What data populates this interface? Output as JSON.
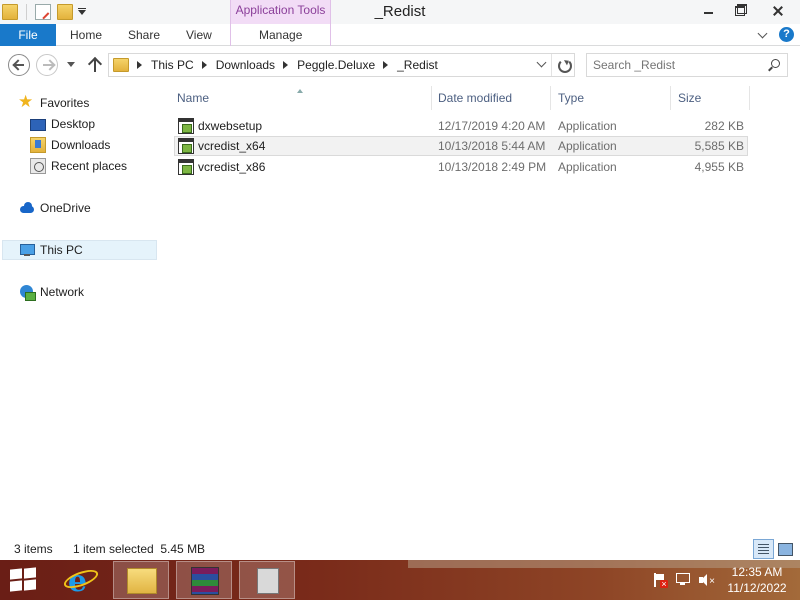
{
  "window": {
    "title": "_Redist",
    "contextual_tab_header": "Application Tools"
  },
  "ribbon": {
    "tabs": [
      "File",
      "Home",
      "Share",
      "View",
      "Manage"
    ],
    "help_label": "?"
  },
  "address": {
    "crumbs": [
      "This PC",
      "Downloads",
      "Peggle.Deluxe",
      "_Redist"
    ]
  },
  "search": {
    "placeholder": "Search _Redist"
  },
  "navpane": {
    "favorites": "Favorites",
    "desktop": "Desktop",
    "downloads": "Downloads",
    "recent_places": "Recent places",
    "onedrive": "OneDrive",
    "this_pc": "This PC",
    "network": "Network"
  },
  "columns": {
    "name": "Name",
    "date_modified": "Date modified",
    "type": "Type",
    "size": "Size"
  },
  "files": [
    {
      "name": "dxwebsetup",
      "date": "12/17/2019 4:20 AM",
      "type": "Application",
      "size": "282 KB",
      "icon": "application-icon",
      "selected": false
    },
    {
      "name": "vcredist_x64",
      "date": "10/13/2018 5:44 AM",
      "type": "Application",
      "size": "5,585 KB",
      "icon": "application-icon",
      "selected": true
    },
    {
      "name": "vcredist_x86",
      "date": "10/13/2018 2:49 PM",
      "type": "Application",
      "size": "4,955 KB",
      "icon": "application-icon",
      "selected": false
    }
  ],
  "status": {
    "item_count": "3 items",
    "selection": "1 item selected  5.45 MB"
  },
  "taskbar": {
    "clock_time": "12:35 AM",
    "clock_date": "11/12/2022"
  },
  "colors": {
    "accent": "#1979ca",
    "contextual": "#f2dcf6",
    "selection": "#e5f3fb"
  }
}
